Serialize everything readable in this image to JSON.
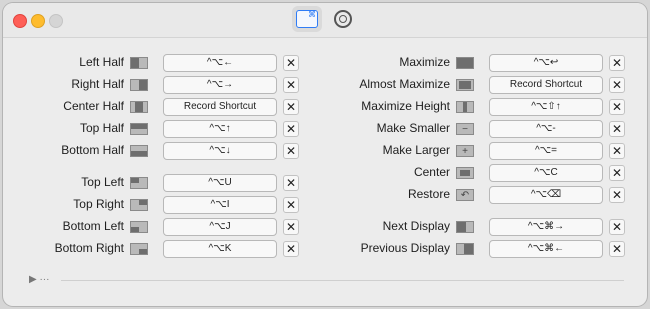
{
  "window": {
    "tabs": [
      {
        "name": "shortcuts-tab",
        "icon": "keyboard-shortcut-icon",
        "active": true
      },
      {
        "name": "settings-tab",
        "icon": "gear-icon",
        "active": false
      }
    ]
  },
  "left_items": [
    {
      "label": "Left Half",
      "shortcut": "^⌥←",
      "icon": "left-half-icon"
    },
    {
      "label": "Right Half",
      "shortcut": "^⌥→",
      "icon": "right-half-icon"
    },
    {
      "label": "Center Half",
      "shortcut": "Record Shortcut",
      "icon": "center-half-icon"
    },
    {
      "label": "Top Half",
      "shortcut": "^⌥↑",
      "icon": "top-half-icon"
    },
    {
      "label": "Bottom Half",
      "shortcut": "^⌥↓",
      "icon": "bottom-half-icon"
    },
    {
      "label": "Top Left",
      "shortcut": "^⌥U",
      "icon": "top-left-icon"
    },
    {
      "label": "Top Right",
      "shortcut": "^⌥I",
      "icon": "top-right-icon"
    },
    {
      "label": "Bottom Left",
      "shortcut": "^⌥J",
      "icon": "bottom-left-icon"
    },
    {
      "label": "Bottom Right",
      "shortcut": "^⌥K",
      "icon": "bottom-right-icon"
    }
  ],
  "right_items": [
    {
      "label": "Maximize",
      "shortcut": "^⌥↩",
      "icon": "maximize-icon"
    },
    {
      "label": "Almost Maximize",
      "shortcut": "Record Shortcut",
      "icon": "almost-maximize-icon"
    },
    {
      "label": "Maximize Height",
      "shortcut": "^⌥⇧↑",
      "icon": "maximize-height-icon"
    },
    {
      "label": "Make Smaller",
      "shortcut": "^⌥-",
      "icon": "make-smaller-icon"
    },
    {
      "label": "Make Larger",
      "shortcut": "^⌥=",
      "icon": "make-larger-icon"
    },
    {
      "label": "Center",
      "shortcut": "^⌥C",
      "icon": "center-icon"
    },
    {
      "label": "Restore",
      "shortcut": "^⌥⌫",
      "icon": "restore-icon"
    },
    {
      "label": "Next Display",
      "shortcut": "^⌥⌘→",
      "icon": "next-display-icon"
    },
    {
      "label": "Previous Display",
      "shortcut": "^⌥⌘←",
      "icon": "previous-display-icon"
    }
  ],
  "clear_glyph": "✕",
  "footer": {
    "more_glyph": "▶ ···"
  }
}
